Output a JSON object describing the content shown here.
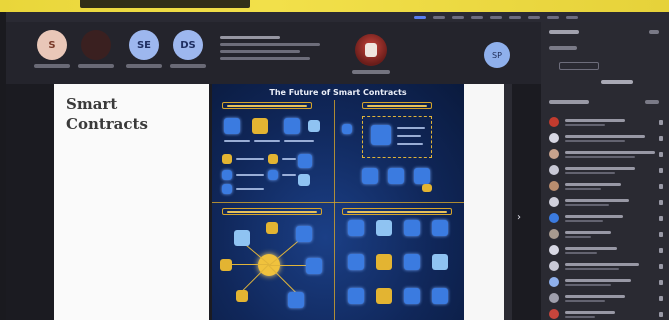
{
  "window": {
    "title": ""
  },
  "controls": {
    "buttons": [
      {
        "initials": "S",
        "label": ""
      },
      {
        "initials": "",
        "label": ""
      },
      {
        "initials": "SE",
        "label": ""
      },
      {
        "initials": "DS",
        "label": ""
      }
    ],
    "speaker_label": "",
    "share_label": "SP"
  },
  "slide": {
    "title": "Smart Contracts"
  },
  "infographic": {
    "title": "The Future of Smart Contracts"
  },
  "sidebar": {
    "header": "",
    "search_placeholder": "",
    "section_title": "",
    "participants": [
      {
        "name": "",
        "avatar_color": "#c23b2e"
      },
      {
        "name": "",
        "avatar_color": "#d8d8e4"
      },
      {
        "name": "",
        "avatar_color": "#c8a28c"
      },
      {
        "name": "",
        "avatar_color": "#c9c9d6"
      },
      {
        "name": "",
        "avatar_color": "#b98d6f"
      },
      {
        "name": "",
        "avatar_color": "#d0d0dc"
      },
      {
        "name": "",
        "avatar_color": "#3b7be0"
      },
      {
        "name": "",
        "avatar_color": "#a89a8f"
      },
      {
        "name": "",
        "avatar_color": "#d8d8e4"
      },
      {
        "name": "",
        "avatar_color": "#c9c9d6"
      },
      {
        "name": "",
        "avatar_color": "#8fb0ec"
      },
      {
        "name": "",
        "avatar_color": "#a0a0ad"
      },
      {
        "name": "",
        "avatar_color": "#c8453c"
      }
    ]
  },
  "colors": {
    "accent": "#5a7ef0",
    "banner": "#f2e04a",
    "infographic_gold": "#e3b432"
  }
}
